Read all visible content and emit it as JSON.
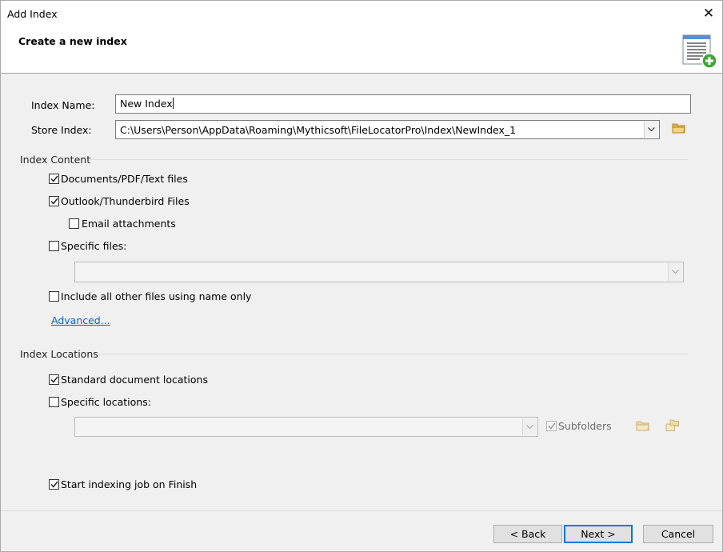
{
  "window": {
    "title": "Add Index",
    "close_glyph": "✕"
  },
  "header": {
    "title": "Create a new index",
    "icon": "add-index-icon"
  },
  "form": {
    "index_name_label": "Index Name:",
    "index_name_value": "New Index",
    "store_index_label": "Store Index:",
    "store_index_value": "C:\\Users\\Person\\AppData\\Roaming\\Mythicsoft\\FileLocatorPro\\Index\\NewIndex_1"
  },
  "index_content": {
    "title": "Index Content",
    "documents": {
      "label": "Documents/PDF/Text files",
      "checked": true
    },
    "outlook": {
      "label": "Outlook/Thunderbird Files",
      "checked": true
    },
    "email_attachments": {
      "label": "Email attachments",
      "checked": false
    },
    "specific_files": {
      "label": "Specific files:",
      "checked": false,
      "value": ""
    },
    "include_other": {
      "label": "Include all other files using name only",
      "checked": false
    },
    "advanced_link": "Advanced..."
  },
  "index_locations": {
    "title": "Index Locations",
    "standard": {
      "label": "Standard document locations",
      "checked": true
    },
    "specific": {
      "label": "Specific locations:",
      "checked": false,
      "value": ""
    },
    "subfolders": {
      "label": "Subfolders",
      "checked": true
    }
  },
  "start_job": {
    "label": "Start indexing job on Finish",
    "checked": true
  },
  "buttons": {
    "back": "< Back",
    "next": "Next >",
    "cancel": "Cancel"
  },
  "colors": {
    "accent": "#0078d7",
    "link": "#0066cc",
    "folder": "#e3b44c",
    "add_green": "#3fa535"
  }
}
